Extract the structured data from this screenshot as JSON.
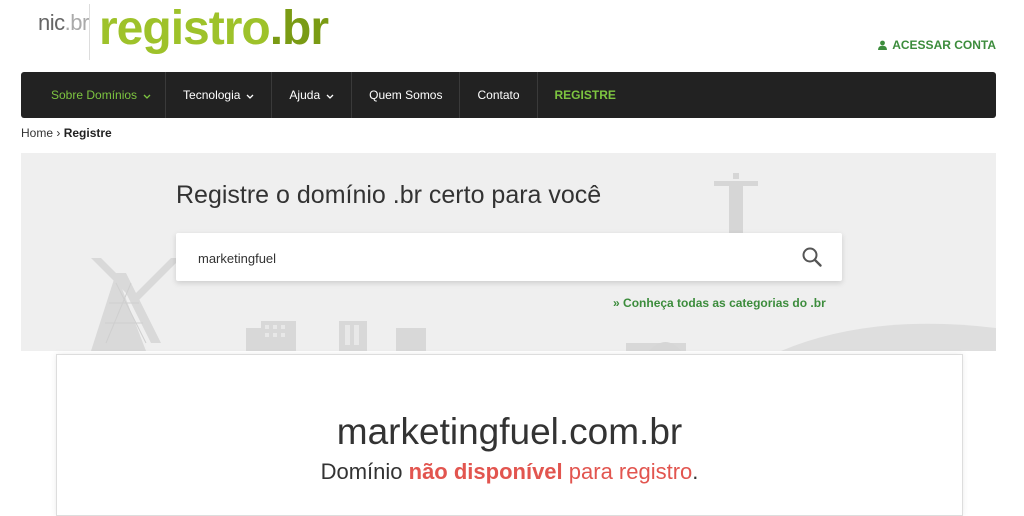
{
  "header": {
    "logo_nic": "nic",
    "logo_nic_tld": ".br",
    "logo_registro": "registro",
    "logo_registro_tld": ".br",
    "account_label": "ACESSAR CONTA",
    "account_icon": "user-icon"
  },
  "nav": {
    "items": [
      {
        "label": "Sobre Domínios",
        "has_dropdown": true
      },
      {
        "label": "Tecnologia",
        "has_dropdown": true
      },
      {
        "label": "Ajuda",
        "has_dropdown": true
      },
      {
        "label": "Quem Somos",
        "has_dropdown": false
      },
      {
        "label": "Contato",
        "has_dropdown": false
      },
      {
        "label": "REGISTRE",
        "has_dropdown": false
      }
    ]
  },
  "breadcrumb": {
    "home": "Home",
    "separator": "›",
    "current": "Registre"
  },
  "search": {
    "title": "Registre o domínio .br certo para você",
    "value": "marketingfuel",
    "button_icon": "search-icon",
    "categories_prefix": "»",
    "categories_link": "Conheça todas as categorias do .br"
  },
  "result": {
    "domain": "marketingfuel.com.br",
    "status_prefix": "Domínio",
    "status_strong": "não disponível",
    "status_soft": "para registro",
    "status_suffix": "."
  },
  "colors": {
    "brand_green": "#9ec22a",
    "link_green": "#3c8c3c",
    "nav_bg": "#222222",
    "unavailable_red": "#e2554f"
  }
}
